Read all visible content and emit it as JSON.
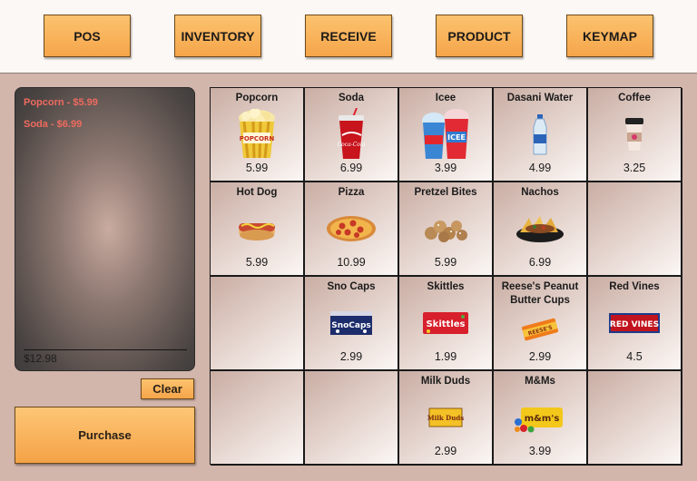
{
  "nav": {
    "pos": "POS",
    "inventory": "INVENTORY",
    "receive": "RECEIVE",
    "product": "PRODUCT",
    "keymap": "KEYMAP"
  },
  "receipt": {
    "items": [
      "Popcorn - $5.99",
      "Soda - $6.99"
    ],
    "total": "$12.98"
  },
  "buttons": {
    "clear": "Clear",
    "purchase": "Purchase"
  },
  "products": [
    {
      "name": "Popcorn",
      "price": "5.99",
      "icon": "popcorn-icon"
    },
    {
      "name": "Soda",
      "price": "6.99",
      "icon": "soda-cup-icon"
    },
    {
      "name": "Icee",
      "price": "3.99",
      "icon": "icee-cup-icon"
    },
    {
      "name": "Dasani Water",
      "price": "4.99",
      "icon": "water-bottle-icon"
    },
    {
      "name": "Coffee",
      "price": "3.25",
      "icon": "coffee-cup-icon"
    },
    {
      "name": "Hot Dog",
      "price": "5.99",
      "icon": "hot-dog-icon"
    },
    {
      "name": "Pizza",
      "price": "10.99",
      "icon": "pizza-icon"
    },
    {
      "name": "Pretzel Bites",
      "price": "5.99",
      "icon": "pretzel-bites-icon"
    },
    {
      "name": "Nachos",
      "price": "6.99",
      "icon": "nachos-icon"
    },
    {
      "name": "",
      "price": "",
      "icon": ""
    },
    {
      "name": "",
      "price": "",
      "icon": ""
    },
    {
      "name": "Sno Caps",
      "price": "2.99",
      "icon": "sno-caps-box-icon"
    },
    {
      "name": "Skittles",
      "price": "1.99",
      "icon": "skittles-pack-icon"
    },
    {
      "name": "Reese's Peanut Butter Cups",
      "price": "2.99",
      "icon": "reeses-pack-icon"
    },
    {
      "name": "Red Vines",
      "price": "4.5",
      "icon": "red-vines-box-icon"
    },
    {
      "name": "",
      "price": "",
      "icon": ""
    },
    {
      "name": "",
      "price": "",
      "icon": ""
    },
    {
      "name": "Milk Duds",
      "price": "2.99",
      "icon": "milk-duds-box-icon"
    },
    {
      "name": "M&Ms",
      "price": "3.99",
      "icon": "mms-pack-icon"
    },
    {
      "name": "",
      "price": "",
      "icon": ""
    }
  ],
  "colors": {
    "accent_orange": "#f5a54a",
    "receipt_item_red": "#ef6b5f",
    "background": "#d2b5ab"
  }
}
